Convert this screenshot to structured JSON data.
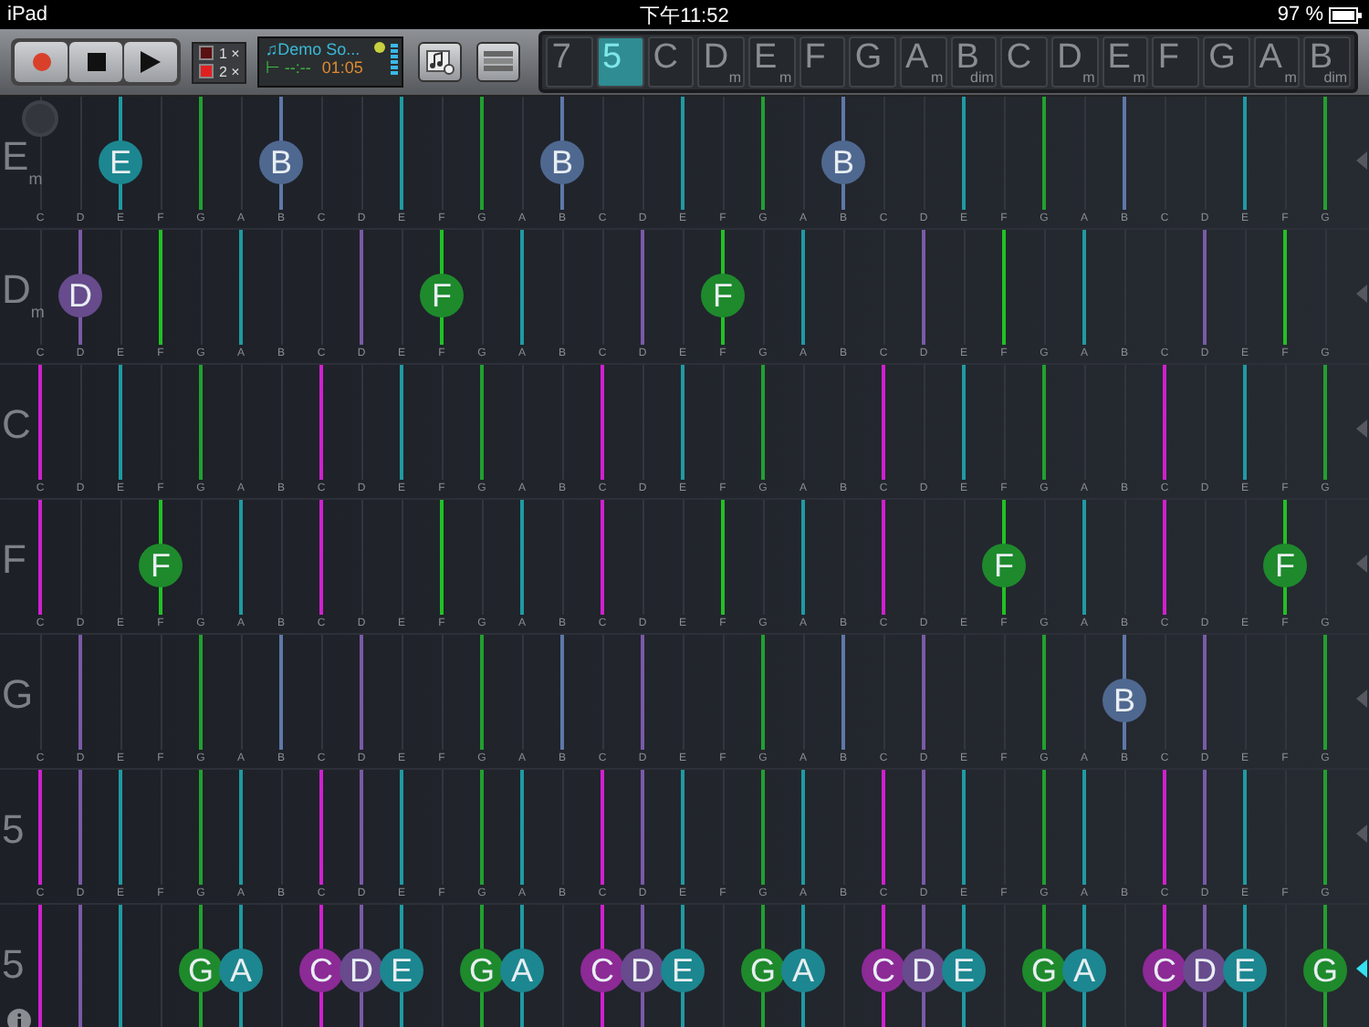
{
  "status_bar": {
    "device": "iPad",
    "time": "下午11:52",
    "battery": "97 %"
  },
  "toolbar": {
    "loop_options": [
      {
        "label": "1 ×",
        "selected": false
      },
      {
        "label": "2 ×",
        "selected": true
      }
    ],
    "song": {
      "title": "♫Demo So...",
      "position": "⊢ --:--",
      "time": "01:05"
    }
  },
  "chord_strip": [
    {
      "root": "7",
      "selected": false
    },
    {
      "root": "5",
      "selected": true
    },
    {
      "root": "C",
      "selected": false
    },
    {
      "root": "D",
      "quality": "m",
      "selected": false
    },
    {
      "root": "E",
      "quality": "m",
      "selected": false
    },
    {
      "root": "F",
      "selected": false
    },
    {
      "root": "G",
      "selected": false
    },
    {
      "root": "A",
      "quality": "m",
      "selected": false
    },
    {
      "root": "B",
      "quality": "dim",
      "selected": false
    },
    {
      "root": "C",
      "selected": false
    },
    {
      "root": "D",
      "quality": "m",
      "selected": false
    },
    {
      "root": "E",
      "quality": "m",
      "selected": false
    },
    {
      "root": "F",
      "selected": false
    },
    {
      "root": "G",
      "selected": false
    },
    {
      "root": "A",
      "quality": "m",
      "selected": false
    },
    {
      "root": "B",
      "quality": "dim",
      "selected": false
    }
  ],
  "lanes": [
    {
      "root": "E",
      "quality": "m",
      "selected": false,
      "cells": [
        {
          "label": "C",
          "line": false
        },
        {
          "label": "D",
          "line": false
        },
        {
          "label": "E",
          "line": true,
          "bubble": "E",
          "color": "#1c8790"
        },
        {
          "label": "F",
          "line": false
        },
        {
          "label": "G",
          "line": true
        },
        {
          "label": "A",
          "line": false
        },
        {
          "label": "B",
          "line": true,
          "bubble": "B",
          "color": "#4f6890"
        },
        {
          "label": "C",
          "line": false
        },
        {
          "label": "D",
          "line": false
        },
        {
          "label": "E",
          "line": true
        },
        {
          "label": "F",
          "line": false
        },
        {
          "label": "G",
          "line": true
        },
        {
          "label": "A",
          "line": false
        },
        {
          "label": "B",
          "line": true,
          "bubble": "B",
          "color": "#4f6890"
        },
        {
          "label": "C",
          "line": false
        },
        {
          "label": "D",
          "line": false
        },
        {
          "label": "E",
          "line": true
        },
        {
          "label": "F",
          "line": false
        },
        {
          "label": "G",
          "line": true
        },
        {
          "label": "A",
          "line": false
        },
        {
          "label": "B",
          "line": true,
          "bubble": "B",
          "color": "#4f6890"
        },
        {
          "label": "C",
          "line": false
        },
        {
          "label": "D",
          "line": false
        },
        {
          "label": "E",
          "line": true
        },
        {
          "label": "F",
          "line": false
        },
        {
          "label": "G",
          "line": true
        },
        {
          "label": "A",
          "line": false
        },
        {
          "label": "B",
          "line": true
        },
        {
          "label": "C",
          "line": false
        },
        {
          "label": "D",
          "line": false
        },
        {
          "label": "E",
          "line": true
        },
        {
          "label": "F",
          "line": false
        },
        {
          "label": "G",
          "line": true
        }
      ]
    },
    {
      "root": "D",
      "quality": "m",
      "selected": false,
      "cells": [
        {
          "label": "C",
          "line": false
        },
        {
          "label": "D",
          "line": true,
          "bubble": "D",
          "color": "#674b8c"
        },
        {
          "label": "E",
          "line": false
        },
        {
          "label": "F",
          "line": true
        },
        {
          "label": "G",
          "line": false
        },
        {
          "label": "A",
          "line": true
        },
        {
          "label": "B",
          "line": false
        },
        {
          "label": "C",
          "line": false
        },
        {
          "label": "D",
          "line": true
        },
        {
          "label": "E",
          "line": false
        },
        {
          "label": "F",
          "line": true,
          "bubble": "F",
          "color": "#1e8a2c"
        },
        {
          "label": "G",
          "line": false
        },
        {
          "label": "A",
          "line": true
        },
        {
          "label": "B",
          "line": false
        },
        {
          "label": "C",
          "line": false
        },
        {
          "label": "D",
          "line": true
        },
        {
          "label": "E",
          "line": false
        },
        {
          "label": "F",
          "line": true,
          "bubble": "F",
          "color": "#1e8a2c"
        },
        {
          "label": "G",
          "line": false
        },
        {
          "label": "A",
          "line": true
        },
        {
          "label": "B",
          "line": false
        },
        {
          "label": "C",
          "line": false
        },
        {
          "label": "D",
          "line": true
        },
        {
          "label": "E",
          "line": false
        },
        {
          "label": "F",
          "line": true
        },
        {
          "label": "G",
          "line": false
        },
        {
          "label": "A",
          "line": true
        },
        {
          "label": "B",
          "line": false
        },
        {
          "label": "C",
          "line": false
        },
        {
          "label": "D",
          "line": true
        },
        {
          "label": "E",
          "line": false
        },
        {
          "label": "F",
          "line": true
        },
        {
          "label": "G",
          "line": false
        }
      ]
    },
    {
      "root": "C",
      "selected": false,
      "cells": [
        {
          "label": "C",
          "line": true
        },
        {
          "label": "D",
          "line": false
        },
        {
          "label": "E",
          "line": true
        },
        {
          "label": "F",
          "line": false
        },
        {
          "label": "G",
          "line": true
        },
        {
          "label": "A",
          "line": false
        },
        {
          "label": "B",
          "line": false
        },
        {
          "label": "C",
          "line": true
        },
        {
          "label": "D",
          "line": false
        },
        {
          "label": "E",
          "line": true
        },
        {
          "label": "F",
          "line": false
        },
        {
          "label": "G",
          "line": true
        },
        {
          "label": "A",
          "line": false
        },
        {
          "label": "B",
          "line": false
        },
        {
          "label": "C",
          "line": true
        },
        {
          "label": "D",
          "line": false
        },
        {
          "label": "E",
          "line": true
        },
        {
          "label": "F",
          "line": false
        },
        {
          "label": "G",
          "line": true
        },
        {
          "label": "A",
          "line": false
        },
        {
          "label": "B",
          "line": false
        },
        {
          "label": "C",
          "line": true
        },
        {
          "label": "D",
          "line": false
        },
        {
          "label": "E",
          "line": true
        },
        {
          "label": "F",
          "line": false
        },
        {
          "label": "G",
          "line": true
        },
        {
          "label": "A",
          "line": false
        },
        {
          "label": "B",
          "line": false
        },
        {
          "label": "C",
          "line": true
        },
        {
          "label": "D",
          "line": false
        },
        {
          "label": "E",
          "line": true
        },
        {
          "label": "F",
          "line": false
        },
        {
          "label": "G",
          "line": true
        }
      ]
    },
    {
      "root": "F",
      "selected": false,
      "cells": [
        {
          "label": "C",
          "line": true
        },
        {
          "label": "D",
          "line": false
        },
        {
          "label": "E",
          "line": false
        },
        {
          "label": "F",
          "line": true,
          "bubble": "F",
          "color": "#1e8a2c"
        },
        {
          "label": "G",
          "line": false
        },
        {
          "label": "A",
          "line": true
        },
        {
          "label": "B",
          "line": false
        },
        {
          "label": "C",
          "line": true
        },
        {
          "label": "D",
          "line": false
        },
        {
          "label": "E",
          "line": false
        },
        {
          "label": "F",
          "line": true
        },
        {
          "label": "G",
          "line": false
        },
        {
          "label": "A",
          "line": true
        },
        {
          "label": "B",
          "line": false
        },
        {
          "label": "C",
          "line": true
        },
        {
          "label": "D",
          "line": false
        },
        {
          "label": "E",
          "line": false
        },
        {
          "label": "F",
          "line": true
        },
        {
          "label": "G",
          "line": false
        },
        {
          "label": "A",
          "line": true
        },
        {
          "label": "B",
          "line": false
        },
        {
          "label": "C",
          "line": true
        },
        {
          "label": "D",
          "line": false
        },
        {
          "label": "E",
          "line": false
        },
        {
          "label": "F",
          "line": true,
          "bubble": "F",
          "color": "#1e8a2c"
        },
        {
          "label": "G",
          "line": false
        },
        {
          "label": "A",
          "line": true
        },
        {
          "label": "B",
          "line": false
        },
        {
          "label": "C",
          "line": true
        },
        {
          "label": "D",
          "line": false
        },
        {
          "label": "E",
          "line": false
        },
        {
          "label": "F",
          "line": true,
          "bubble": "F",
          "color": "#1e8a2c"
        },
        {
          "label": "G",
          "line": false
        }
      ]
    },
    {
      "root": "G",
      "selected": false,
      "cells": [
        {
          "label": "C",
          "line": false
        },
        {
          "label": "D",
          "line": true
        },
        {
          "label": "E",
          "line": false
        },
        {
          "label": "F",
          "line": false
        },
        {
          "label": "G",
          "line": true
        },
        {
          "label": "A",
          "line": false
        },
        {
          "label": "B",
          "line": true
        },
        {
          "label": "C",
          "line": false
        },
        {
          "label": "D",
          "line": true
        },
        {
          "label": "E",
          "line": false
        },
        {
          "label": "F",
          "line": false
        },
        {
          "label": "G",
          "line": true
        },
        {
          "label": "A",
          "line": false
        },
        {
          "label": "B",
          "line": true
        },
        {
          "label": "C",
          "line": false
        },
        {
          "label": "D",
          "line": true
        },
        {
          "label": "E",
          "line": false
        },
        {
          "label": "F",
          "line": false
        },
        {
          "label": "G",
          "line": true
        },
        {
          "label": "A",
          "line": false
        },
        {
          "label": "B",
          "line": true
        },
        {
          "label": "C",
          "line": false
        },
        {
          "label": "D",
          "line": true
        },
        {
          "label": "E",
          "line": false
        },
        {
          "label": "F",
          "line": false
        },
        {
          "label": "G",
          "line": true
        },
        {
          "label": "A",
          "line": false
        },
        {
          "label": "B",
          "line": true,
          "bubble": "B",
          "color": "#4f6890"
        },
        {
          "label": "C",
          "line": false
        },
        {
          "label": "D",
          "line": true
        },
        {
          "label": "E",
          "line": false
        },
        {
          "label": "F",
          "line": false
        },
        {
          "label": "G",
          "line": true
        }
      ]
    },
    {
      "root": "5",
      "selected": false,
      "cells": [
        {
          "label": "C",
          "line": true
        },
        {
          "label": "D",
          "line": true
        },
        {
          "label": "E",
          "line": true
        },
        {
          "label": "F",
          "line": false
        },
        {
          "label": "G",
          "line": true
        },
        {
          "label": "A",
          "line": true
        },
        {
          "label": "B",
          "line": false
        },
        {
          "label": "C",
          "line": true
        },
        {
          "label": "D",
          "line": true
        },
        {
          "label": "E",
          "line": true
        },
        {
          "label": "F",
          "line": false
        },
        {
          "label": "G",
          "line": true
        },
        {
          "label": "A",
          "line": true
        },
        {
          "label": "B",
          "line": false
        },
        {
          "label": "C",
          "line": true
        },
        {
          "label": "D",
          "line": true
        },
        {
          "label": "E",
          "line": true
        },
        {
          "label": "F",
          "line": false
        },
        {
          "label": "G",
          "line": true
        },
        {
          "label": "A",
          "line": true
        },
        {
          "label": "B",
          "line": false
        },
        {
          "label": "C",
          "line": true
        },
        {
          "label": "D",
          "line": true
        },
        {
          "label": "E",
          "line": true
        },
        {
          "label": "F",
          "line": false
        },
        {
          "label": "G",
          "line": true
        },
        {
          "label": "A",
          "line": true
        },
        {
          "label": "B",
          "line": false
        },
        {
          "label": "C",
          "line": true
        },
        {
          "label": "D",
          "line": true
        },
        {
          "label": "E",
          "line": true
        },
        {
          "label": "F",
          "line": false
        },
        {
          "label": "G",
          "line": true
        }
      ]
    },
    {
      "root": "5",
      "selected": true,
      "cells": [
        {
          "line": true
        },
        {
          "line": true
        },
        {
          "line": true
        },
        {
          "line": false
        },
        {
          "line": true,
          "bubble": "G",
          "color": "#1e8a2c"
        },
        {
          "line": true,
          "bubble": "A",
          "color": "#1c8790"
        },
        {
          "line": false
        },
        {
          "line": true,
          "bubble": "C",
          "color": "#8c2a96"
        },
        {
          "line": true,
          "bubble": "D",
          "color": "#674b8c"
        },
        {
          "line": true,
          "bubble": "E",
          "color": "#1c8790"
        },
        {
          "line": false
        },
        {
          "line": true,
          "bubble": "G",
          "color": "#1e8a2c"
        },
        {
          "line": true,
          "bubble": "A",
          "color": "#1c8790"
        },
        {
          "line": false
        },
        {
          "line": true,
          "bubble": "C",
          "color": "#8c2a96"
        },
        {
          "line": true,
          "bubble": "D",
          "color": "#674b8c"
        },
        {
          "line": true,
          "bubble": "E",
          "color": "#1c8790"
        },
        {
          "line": false
        },
        {
          "line": true,
          "bubble": "G",
          "color": "#1e8a2c"
        },
        {
          "line": true,
          "bubble": "A",
          "color": "#1c8790"
        },
        {
          "line": false
        },
        {
          "line": true,
          "bubble": "C",
          "color": "#8c2a96"
        },
        {
          "line": true,
          "bubble": "D",
          "color": "#674b8c"
        },
        {
          "line": true,
          "bubble": "E",
          "color": "#1c8790"
        },
        {
          "line": false
        },
        {
          "line": true,
          "bubble": "G",
          "color": "#1e8a2c"
        },
        {
          "line": true,
          "bubble": "A",
          "color": "#1c8790"
        },
        {
          "line": false
        },
        {
          "line": true,
          "bubble": "C",
          "color": "#8c2a96"
        },
        {
          "line": true,
          "bubble": "D",
          "color": "#674b8c"
        },
        {
          "line": true,
          "bubble": "E",
          "color": "#1c8790"
        },
        {
          "line": false
        },
        {
          "line": true,
          "bubble": "G",
          "color": "#1e8a2c"
        }
      ]
    }
  ]
}
